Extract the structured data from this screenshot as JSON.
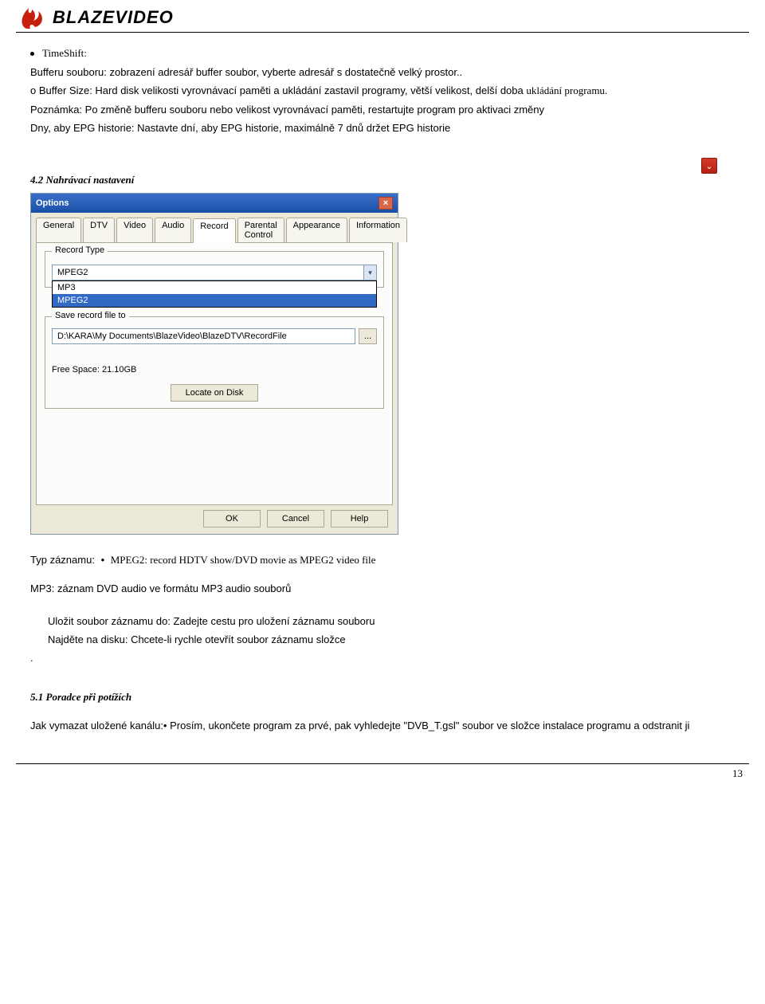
{
  "brand": "BLAZEVIDEO",
  "timeshift": {
    "label": "TimeShift:",
    "buffer_line": "Bufferu souboru: zobrazení adresář buffer soubor, vyberte adresář s dostatečně velký prostor..",
    "buffer_size_prefix": "o Buffer Size: Hard disk velikosti vyrovnávací paměti a ukládání zastavil programy, větší velikost, delší doba",
    "serif_tail": "ukládání    programu.",
    "note": "Poznámka: Po změně bufferu souboru nebo velikost vyrovnávací paměti, restartujte program pro aktivaci změny",
    "dny": "Dny, aby EPG historie: Nastavte dní, aby EPG historie, maximálně 7 dnů držet EPG historie"
  },
  "red_glyph": "⌄",
  "heading_record": "4.2 Nahrávací nastavení",
  "options": {
    "title": "Options",
    "tabs": {
      "general": "General",
      "dtv": "DTV",
      "video": "Video",
      "audio": "Audio",
      "record": "Record",
      "parental": "Parental Control",
      "appearance": "Appearance",
      "information": "Information"
    },
    "record_type_label": "Record Type",
    "combo_value": "MPEG2",
    "dd_mp3": "MP3",
    "dd_mpeg2": "MPEG2",
    "save_label": "Save record file to",
    "path": "D:\\KARA\\My Documents\\BlazeVideo\\BlazeDTV\\RecordFile",
    "browse": "...",
    "free_space": "Free Space: 21.10GB",
    "locate": "Locate on Disk",
    "ok": "OK",
    "cancel": "Cancel",
    "help": "Help"
  },
  "typ_zaznamu": {
    "label": "Typ záznamu:",
    "mpeg2": "MPEG2:    record HDTV show/DVD movie as MPEG2 video file",
    "mp3": "MP3: záznam DVD audio ve formátu MP3 audio souborů",
    "save_to": "Uložit soubor záznamu do: Zadejte cestu pro uložení záznamu souboru",
    "locate": "Najděte na disku: Chcete-li rychle otevřít soubor záznamu složce",
    "dot": "."
  },
  "heading_trouble": "5.1 Poradce při potížích",
  "trouble_line": "Jak vymazat uložené kanálu:• Prosím, ukončete program za prvé, pak vyhledejte \"DVB_T.gsl\" soubor ve složce instalace programu a odstranit ji",
  "page_number": "13"
}
